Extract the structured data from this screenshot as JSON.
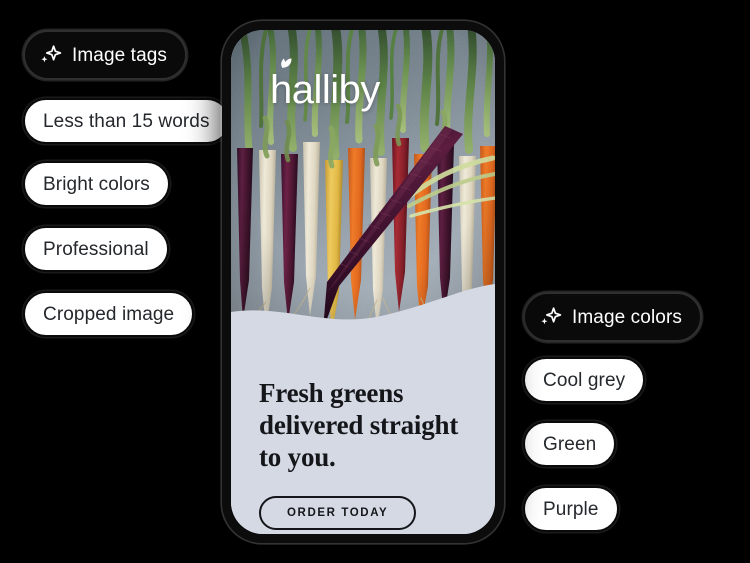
{
  "background_color": "#000000",
  "panels": {
    "image_tags": {
      "header": {
        "label": "Image tags",
        "icon": "sparkle-icon",
        "background_color": "#0a0a0a",
        "text_color": "#ffffff"
      },
      "tags": [
        {
          "label": "Less than 15 words"
        },
        {
          "label": "Bright colors"
        },
        {
          "label": "Professional"
        },
        {
          "label": "Cropped image"
        }
      ]
    },
    "image_colors": {
      "header": {
        "label": "Image colors",
        "icon": "sparkle-icon",
        "background_color": "#0a0a0a",
        "text_color": "#ffffff"
      },
      "colors": [
        {
          "label": "Cool grey"
        },
        {
          "label": "Green"
        },
        {
          "label": "Purple"
        }
      ]
    }
  },
  "phone_mockup": {
    "frame_color": "#0c0c0d",
    "screen": {
      "brand": {
        "name": "halliby",
        "logo_icon": "leaf-sprout-icon",
        "color": "#ffffff"
      },
      "photo": {
        "alt_subject": "rainbow carrots on slate",
        "background_color": "#7a8694"
      },
      "content": {
        "headline": "Fresh greens delivered straight to you.",
        "headline_color": "#14161a",
        "panel_color": "#d5d9e4",
        "cta_label": "ORDER TODAY"
      }
    }
  }
}
